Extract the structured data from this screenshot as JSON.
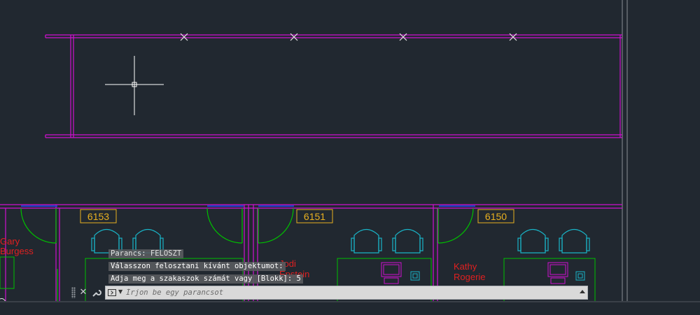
{
  "rooms": [
    "6153",
    "6151",
    "6150"
  ],
  "people": [
    {
      "first": "Gary",
      "last": "Burgess"
    },
    {
      "first": "Jodi",
      "last": "Epstein"
    },
    {
      "first": "Kathy",
      "last": "Rogerie"
    }
  ],
  "command_history": [
    "Parancs: FELOSZT",
    "Válasszon felosztani kívánt objektumot:",
    "Adja meg a szakaszok számát vagy [Blokk]: 5"
  ],
  "command_input": {
    "placeholder": "Írjon be egy parancsot",
    "value": ""
  },
  "icons": {
    "close": "close-icon",
    "customize": "wrench-icon",
    "terminal": "terminal-icon",
    "recent": "chevron-down-icon",
    "scroll": "scroll-up-icon"
  },
  "colors": {
    "background": "#212830",
    "walls": "#d010d0",
    "doors": "#00c000",
    "chairs": "#19b5c8",
    "room_tag": "#e8b020",
    "names": "#e02020",
    "crosshair": "#ffffff"
  }
}
